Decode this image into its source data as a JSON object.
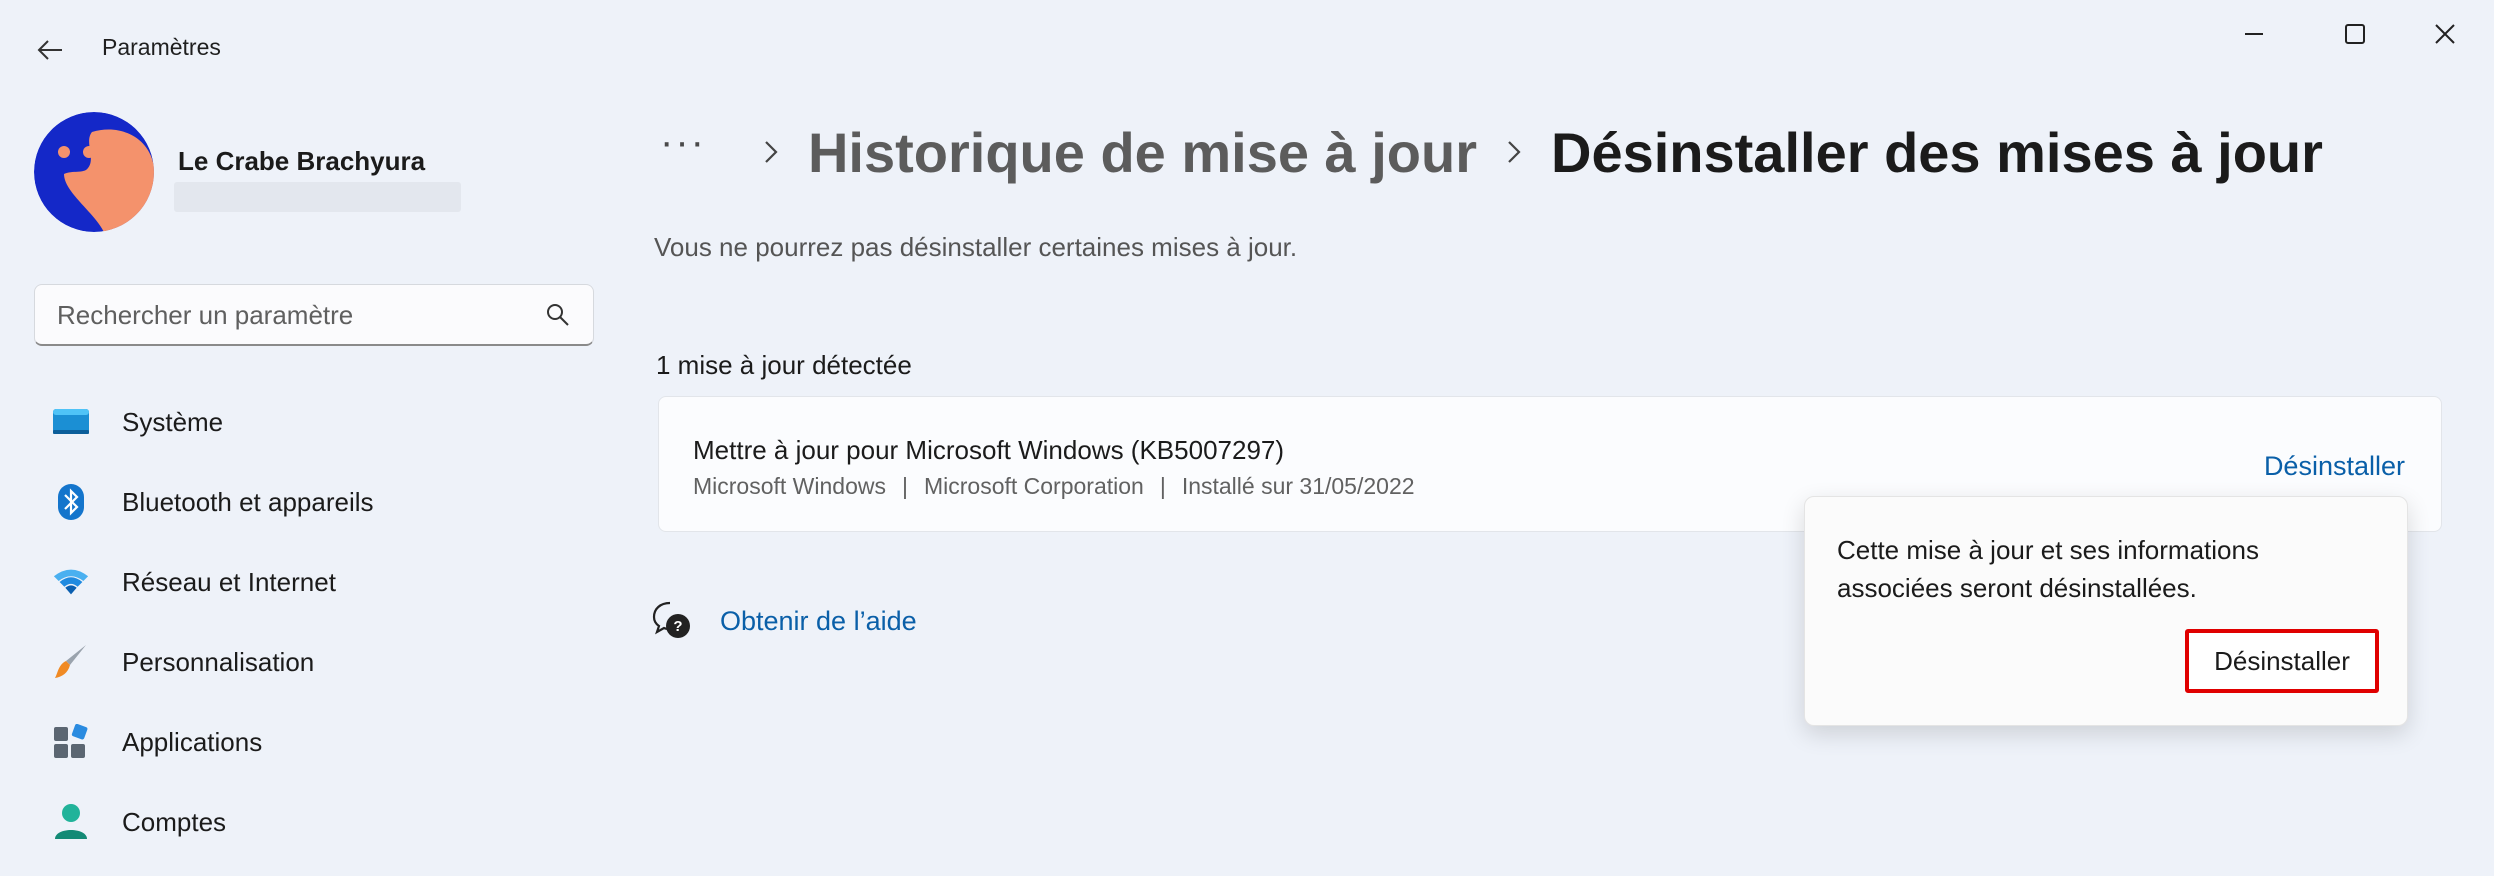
{
  "window": {
    "app_title": "Paramètres",
    "controls": [
      "minimize",
      "maximize",
      "close"
    ]
  },
  "profile": {
    "name": "Le Crabe Brachyura"
  },
  "search": {
    "placeholder": "Rechercher un paramètre",
    "value": ""
  },
  "sidebar": {
    "items": [
      {
        "label": "Système",
        "icon": "system-icon"
      },
      {
        "label": "Bluetooth et appareils",
        "icon": "bluetooth-icon"
      },
      {
        "label": "Réseau et Internet",
        "icon": "wifi-icon"
      },
      {
        "label": "Personnalisation",
        "icon": "brush-icon"
      },
      {
        "label": "Applications",
        "icon": "apps-icon"
      },
      {
        "label": "Comptes",
        "icon": "account-icon"
      }
    ]
  },
  "breadcrumb": {
    "more": "···",
    "previous": "Historique de mise à jour",
    "current": "Désinstaller des mises à jour"
  },
  "main": {
    "subtitle": "Vous ne pourrez pas désinstaller certaines mises à jour.",
    "count_label": "1 mise à jour détectée",
    "update": {
      "title": "Mettre à jour pour Microsoft Windows (KB5007297)",
      "product": "Microsoft Windows",
      "publisher": "Microsoft Corporation",
      "installed": "Installé sur 31/05/2022",
      "separator": "|",
      "action_label": "Désinstaller"
    },
    "help_label": "Obtenir de l’aide"
  },
  "flyout": {
    "message": "Cette mise à jour et ses informations associées seront désinstallées.",
    "confirm_label": "Désinstaller"
  },
  "colors": {
    "background": "#eef2f9",
    "link": "#0a5fa8",
    "highlight": "#e00000",
    "avatar_bg": "#1428c8",
    "avatar_accent": "#f4926c"
  }
}
